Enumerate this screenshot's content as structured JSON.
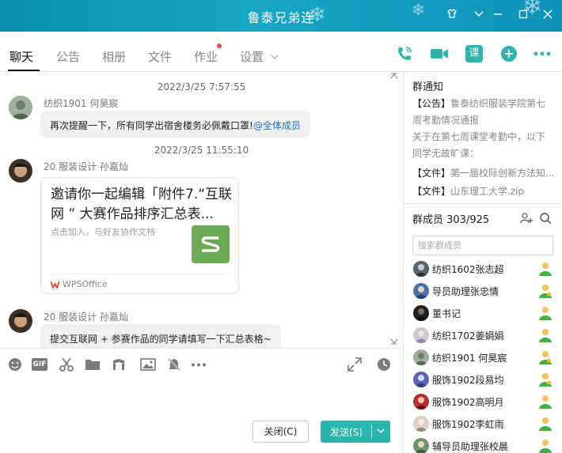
{
  "window": {
    "title": "鲁泰兄弟连"
  },
  "tabs": [
    {
      "label": "聊天",
      "active": true
    },
    {
      "label": "公告"
    },
    {
      "label": "相册"
    },
    {
      "label": "文件"
    },
    {
      "label": "作业",
      "has_dot": true
    },
    {
      "label": "设置"
    }
  ],
  "toolbar_icons": [
    "phone-icon",
    "video-icon",
    "class-icon",
    "add-chat-icon",
    "more-icon"
  ],
  "toolbar": {
    "class_label": "课"
  },
  "chat": {
    "messages": [
      {
        "timestamp": "2022/3/25 7:57:55",
        "sender": "纺织1901 何昊宸",
        "text": "再次提醒一下，所有同学出宿舍楼务必佩戴口罩!",
        "mention": "@全体成员"
      },
      {
        "timestamp": "2022/3/25 11:55:10",
        "sender": "20 服装设计 孙嘉灿",
        "card": {
          "title": "邀请你一起编辑「附件7.“互联网 ” 大赛作品排序汇总表...",
          "subtitle": "点击加入，与好友协作文档",
          "source": "WPSOffice"
        }
      },
      {
        "sender": "20 服装设计 孙嘉灿",
        "text": "提交互联网 + 参赛作品的同学请填写一下汇总表格~"
      }
    ]
  },
  "composer": {
    "tools": [
      "emoji-icon",
      "gif-icon",
      "scissors-icon",
      "folder-icon",
      "music-icon",
      "image-icon",
      "bell-off-icon",
      "more-icon",
      "expand-icon",
      "history-icon"
    ],
    "gif_label": "GIF",
    "close_label": "关闭(C)",
    "send_label": "发送(S)"
  },
  "side": {
    "notice_title": "群通知",
    "notices": [
      {
        "prefix": "【公告】",
        "text": "鲁泰纺织服装学院第七"
      },
      {
        "prefix": "",
        "text": "周考勤情况通报"
      },
      {
        "prefix": "",
        "text": "关于在第七周课堂考勤中，以下"
      },
      {
        "prefix": "",
        "text": "同学无故旷课："
      }
    ],
    "files": [
      {
        "prefix": "【文件】",
        "text": "第一届校际创新方法知..."
      },
      {
        "prefix": "【文件】",
        "text": "山东理工大学.zip"
      }
    ],
    "members_title": "群成员 303/925",
    "search_placeholder": "搜索群成员",
    "members": [
      {
        "name": "纺织1602张志超",
        "role": "user"
      },
      {
        "name": "导员助理张忠情",
        "role": "admin"
      },
      {
        "name": "董书记",
        "role": "user"
      },
      {
        "name": "纺织1702姜娟娟",
        "role": "user"
      },
      {
        "name": "纺织1901 何昊宸",
        "role": "admin"
      },
      {
        "name": "服饰1902段易均",
        "role": "admin"
      },
      {
        "name": "服饰1902高明月",
        "role": "user"
      },
      {
        "name": "服饰1902李虹雨",
        "role": "user"
      },
      {
        "name": "辅导员助理张校晨",
        "role": "user"
      }
    ]
  },
  "colors": {
    "accent": "#2cb5ac",
    "mention": "#1b6fd6",
    "titlebar": "#17a7c7"
  }
}
